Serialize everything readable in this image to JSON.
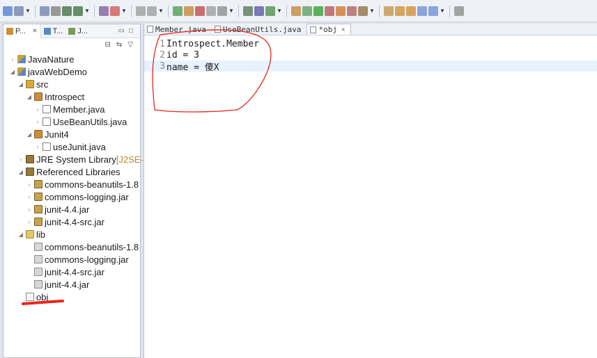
{
  "toolbar": {
    "icons": [
      "new-icon",
      "save-icon",
      "save-all-icon",
      "print-icon",
      "export-icon",
      "import-icon",
      "properties-icon",
      "wizard-icon",
      "undo-icon",
      "redo-icon",
      "run-last-icon",
      "pause-icon",
      "stop-icon",
      "step-icon",
      "lock-icon",
      "terminal-icon",
      "pin-icon",
      "check-icon",
      "search-icon",
      "debug-icon",
      "run-icon",
      "coverage-icon",
      "external-tools-icon",
      "server-icon",
      "open-type-icon",
      "task-icon",
      "back-icon",
      "forward-icon",
      "annotation-icon",
      "link-icon",
      "next-icon"
    ]
  },
  "left_view": {
    "tabs": [
      {
        "label": "P...",
        "icon": "package-explorer-icon",
        "close": "✕",
        "active": true
      },
      {
        "label": "T...",
        "icon": "type-hierarchy-icon",
        "active": false
      },
      {
        "label": "J...",
        "icon": "junit-icon",
        "active": false
      }
    ]
  },
  "tree": {
    "nodes": [
      {
        "label": "JavaNature",
        "icon": "project",
        "indent": 0,
        "twisty": "›"
      },
      {
        "label": "javaWebDemo",
        "icon": "project",
        "indent": 0,
        "twisty": "◢"
      },
      {
        "label": "src",
        "icon": "src",
        "indent": 1,
        "twisty": "◢"
      },
      {
        "label": "Introspect",
        "icon": "pkg",
        "indent": 2,
        "twisty": "◢"
      },
      {
        "label": "Member.java",
        "icon": "java",
        "indent": 3,
        "twisty": "›",
        "selected": true
      },
      {
        "label": "UseBeanUtils.java",
        "icon": "java",
        "indent": 3,
        "twisty": "›"
      },
      {
        "label": "Junit4",
        "icon": "pkg",
        "indent": 2,
        "twisty": "◢"
      },
      {
        "label": "useJunit.java",
        "icon": "java",
        "indent": 3,
        "twisty": "›"
      },
      {
        "label": "JRE System Library",
        "decor": " [J2SE-",
        "icon": "lib",
        "indent": 1,
        "twisty": "›"
      },
      {
        "label": "Referenced Libraries",
        "icon": "lib",
        "indent": 1,
        "twisty": "◢"
      },
      {
        "label": "commons-beanutils-1.8",
        "icon": "jar",
        "indent": 2,
        "twisty": "›"
      },
      {
        "label": "commons-logging.jar",
        "icon": "jar",
        "indent": 2,
        "twisty": "›"
      },
      {
        "label": "junit-4.4.jar",
        "icon": "jar",
        "indent": 2,
        "twisty": "›"
      },
      {
        "label": "junit-4.4-src.jar",
        "icon": "jar",
        "indent": 2,
        "twisty": "›"
      },
      {
        "label": "lib",
        "icon": "folder",
        "indent": 1,
        "twisty": "◢"
      },
      {
        "label": "commons-beanutils-1.8",
        "icon": "jarg",
        "indent": 2,
        "twisty": ""
      },
      {
        "label": "commons-logging.jar",
        "icon": "jarg",
        "indent": 2,
        "twisty": ""
      },
      {
        "label": "junit-4.4-src.jar",
        "icon": "jarg",
        "indent": 2,
        "twisty": ""
      },
      {
        "label": "junit-4.4.jar",
        "icon": "jarg",
        "indent": 2,
        "twisty": ""
      },
      {
        "label": "obj",
        "icon": "file",
        "indent": 1,
        "twisty": ""
      }
    ]
  },
  "editor": {
    "tabs": [
      {
        "label": "Member.java",
        "active": false,
        "dirty": false
      },
      {
        "label": "UseBeanUtils.java",
        "active": false,
        "dirty": false
      },
      {
        "label": "*obj",
        "active": true,
        "dirty": true,
        "close": "✕"
      }
    ],
    "lines": [
      {
        "num": "1",
        "text": "Introspect.Member"
      },
      {
        "num": "2",
        "text": "id = 3"
      },
      {
        "num": "3",
        "text": "name = 傻X",
        "current": true
      }
    ]
  },
  "colors": {
    "annotation_red": "#e8251e",
    "current_line": "#e8f2fe"
  }
}
